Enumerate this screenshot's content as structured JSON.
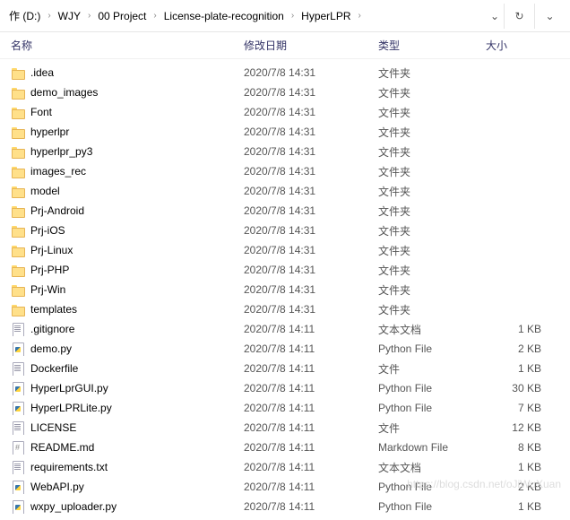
{
  "breadcrumb": {
    "root": "作 (D:)",
    "p1": "WJY",
    "p2": "00 Project",
    "p3": "License-plate-recognition",
    "p4": "HyperLPR"
  },
  "columns": {
    "name": "名称",
    "date": "修改日期",
    "type": "类型",
    "size": "大小"
  },
  "items": [
    {
      "icon": "folder",
      "name": ".idea",
      "date": "2020/7/8 14:31",
      "type": "文件夹",
      "size": ""
    },
    {
      "icon": "folder",
      "name": "demo_images",
      "date": "2020/7/8 14:31",
      "type": "文件夹",
      "size": ""
    },
    {
      "icon": "folder",
      "name": "Font",
      "date": "2020/7/8 14:31",
      "type": "文件夹",
      "size": ""
    },
    {
      "icon": "folder",
      "name": "hyperlpr",
      "date": "2020/7/8 14:31",
      "type": "文件夹",
      "size": ""
    },
    {
      "icon": "folder",
      "name": "hyperlpr_py3",
      "date": "2020/7/8 14:31",
      "type": "文件夹",
      "size": ""
    },
    {
      "icon": "folder",
      "name": "images_rec",
      "date": "2020/7/8 14:31",
      "type": "文件夹",
      "size": ""
    },
    {
      "icon": "folder",
      "name": "model",
      "date": "2020/7/8 14:31",
      "type": "文件夹",
      "size": ""
    },
    {
      "icon": "folder",
      "name": "Prj-Android",
      "date": "2020/7/8 14:31",
      "type": "文件夹",
      "size": ""
    },
    {
      "icon": "folder",
      "name": "Prj-iOS",
      "date": "2020/7/8 14:31",
      "type": "文件夹",
      "size": ""
    },
    {
      "icon": "folder",
      "name": "Prj-Linux",
      "date": "2020/7/8 14:31",
      "type": "文件夹",
      "size": ""
    },
    {
      "icon": "folder",
      "name": "Prj-PHP",
      "date": "2020/7/8 14:31",
      "type": "文件夹",
      "size": ""
    },
    {
      "icon": "folder",
      "name": "Prj-Win",
      "date": "2020/7/8 14:31",
      "type": "文件夹",
      "size": ""
    },
    {
      "icon": "folder",
      "name": "templates",
      "date": "2020/7/8 14:31",
      "type": "文件夹",
      "size": ""
    },
    {
      "icon": "doc",
      "name": ".gitignore",
      "date": "2020/7/8 14:11",
      "type": "文本文档",
      "size": "1 KB"
    },
    {
      "icon": "py",
      "name": "demo.py",
      "date": "2020/7/8 14:11",
      "type": "Python File",
      "size": "2 KB"
    },
    {
      "icon": "doc",
      "name": "Dockerfile",
      "date": "2020/7/8 14:11",
      "type": "文件",
      "size": "1 KB"
    },
    {
      "icon": "py",
      "name": "HyperLprGUI.py",
      "date": "2020/7/8 14:11",
      "type": "Python File",
      "size": "30 KB"
    },
    {
      "icon": "py",
      "name": "HyperLPRLite.py",
      "date": "2020/7/8 14:11",
      "type": "Python File",
      "size": "7 KB"
    },
    {
      "icon": "doc",
      "name": "LICENSE",
      "date": "2020/7/8 14:11",
      "type": "文件",
      "size": "12 KB"
    },
    {
      "icon": "md",
      "name": "README.md",
      "date": "2020/7/8 14:11",
      "type": "Markdown File",
      "size": "8 KB"
    },
    {
      "icon": "doc",
      "name": "requirements.txt",
      "date": "2020/7/8 14:11",
      "type": "文本文档",
      "size": "1 KB"
    },
    {
      "icon": "py",
      "name": "WebAPI.py",
      "date": "2020/7/8 14:11",
      "type": "Python File",
      "size": "2 KB"
    },
    {
      "icon": "py",
      "name": "wxpy_uploader.py",
      "date": "2020/7/8 14:11",
      "type": "Python File",
      "size": "1 KB"
    }
  ],
  "watermark": "https://blog.csdn.net/oJiWuXuan"
}
